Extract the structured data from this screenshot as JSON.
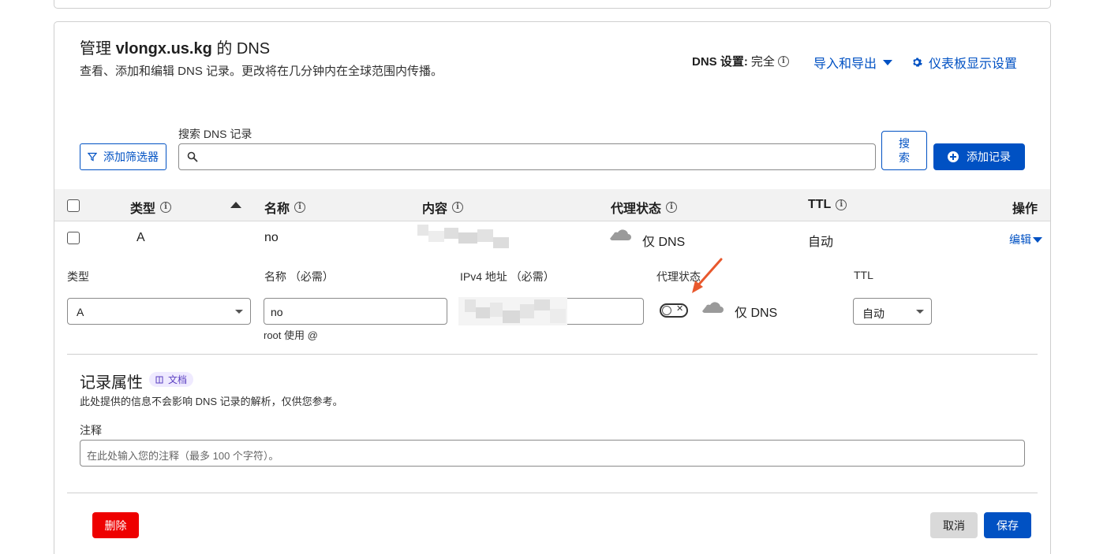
{
  "header": {
    "title_prefix": "管理 ",
    "domain": "vlongx.us.kg",
    "title_suffix": " 的 DNS",
    "description": "查看、添加和编辑 DNS 记录。更改将在几分钟内在全球范围内传播。",
    "dns_setting_label": "DNS 设置:",
    "dns_setting_value": "完全",
    "import_export": "导入和导出",
    "dashboard_settings": "仪表板显示设置"
  },
  "toolbar": {
    "filter_button": "添加筛选器",
    "search_label": "搜索 DNS 记录",
    "search_value": "",
    "search_button": "搜索",
    "add_record_button": "添加记录"
  },
  "table": {
    "columns": {
      "type": "类型",
      "name": "名称",
      "content": "内容",
      "proxy": "代理状态",
      "ttl": "TTL",
      "actions": "操作"
    },
    "rows": [
      {
        "type": "A",
        "name": "no",
        "proxy": "仅 DNS",
        "ttl": "自动",
        "action": "编辑"
      }
    ]
  },
  "edit_form": {
    "type_label": "类型",
    "type_value": "A",
    "name_label": "名称 （必需）",
    "name_value": "no",
    "name_hint": "root 使用 @",
    "ipv4_label": "IPv4 地址 （必需）",
    "proxy_label": "代理状态",
    "proxy_value": "仅 DNS",
    "ttl_label": "TTL",
    "ttl_value": "自动",
    "proxied": false
  },
  "attributes": {
    "title": "记录属性",
    "doc_badge": "文档",
    "description": "此处提供的信息不会影响 DNS 记录的解析，仅供您参考。",
    "note_label": "注释",
    "note_placeholder": "在此处输入您的注释（最多 100 个字符）。"
  },
  "actions": {
    "delete": "删除",
    "cancel": "取消",
    "save": "保存"
  },
  "colors": {
    "link_blue": "#0051c3",
    "delete_red": "#ee0000",
    "annotation_arrow": "#e8582d"
  }
}
